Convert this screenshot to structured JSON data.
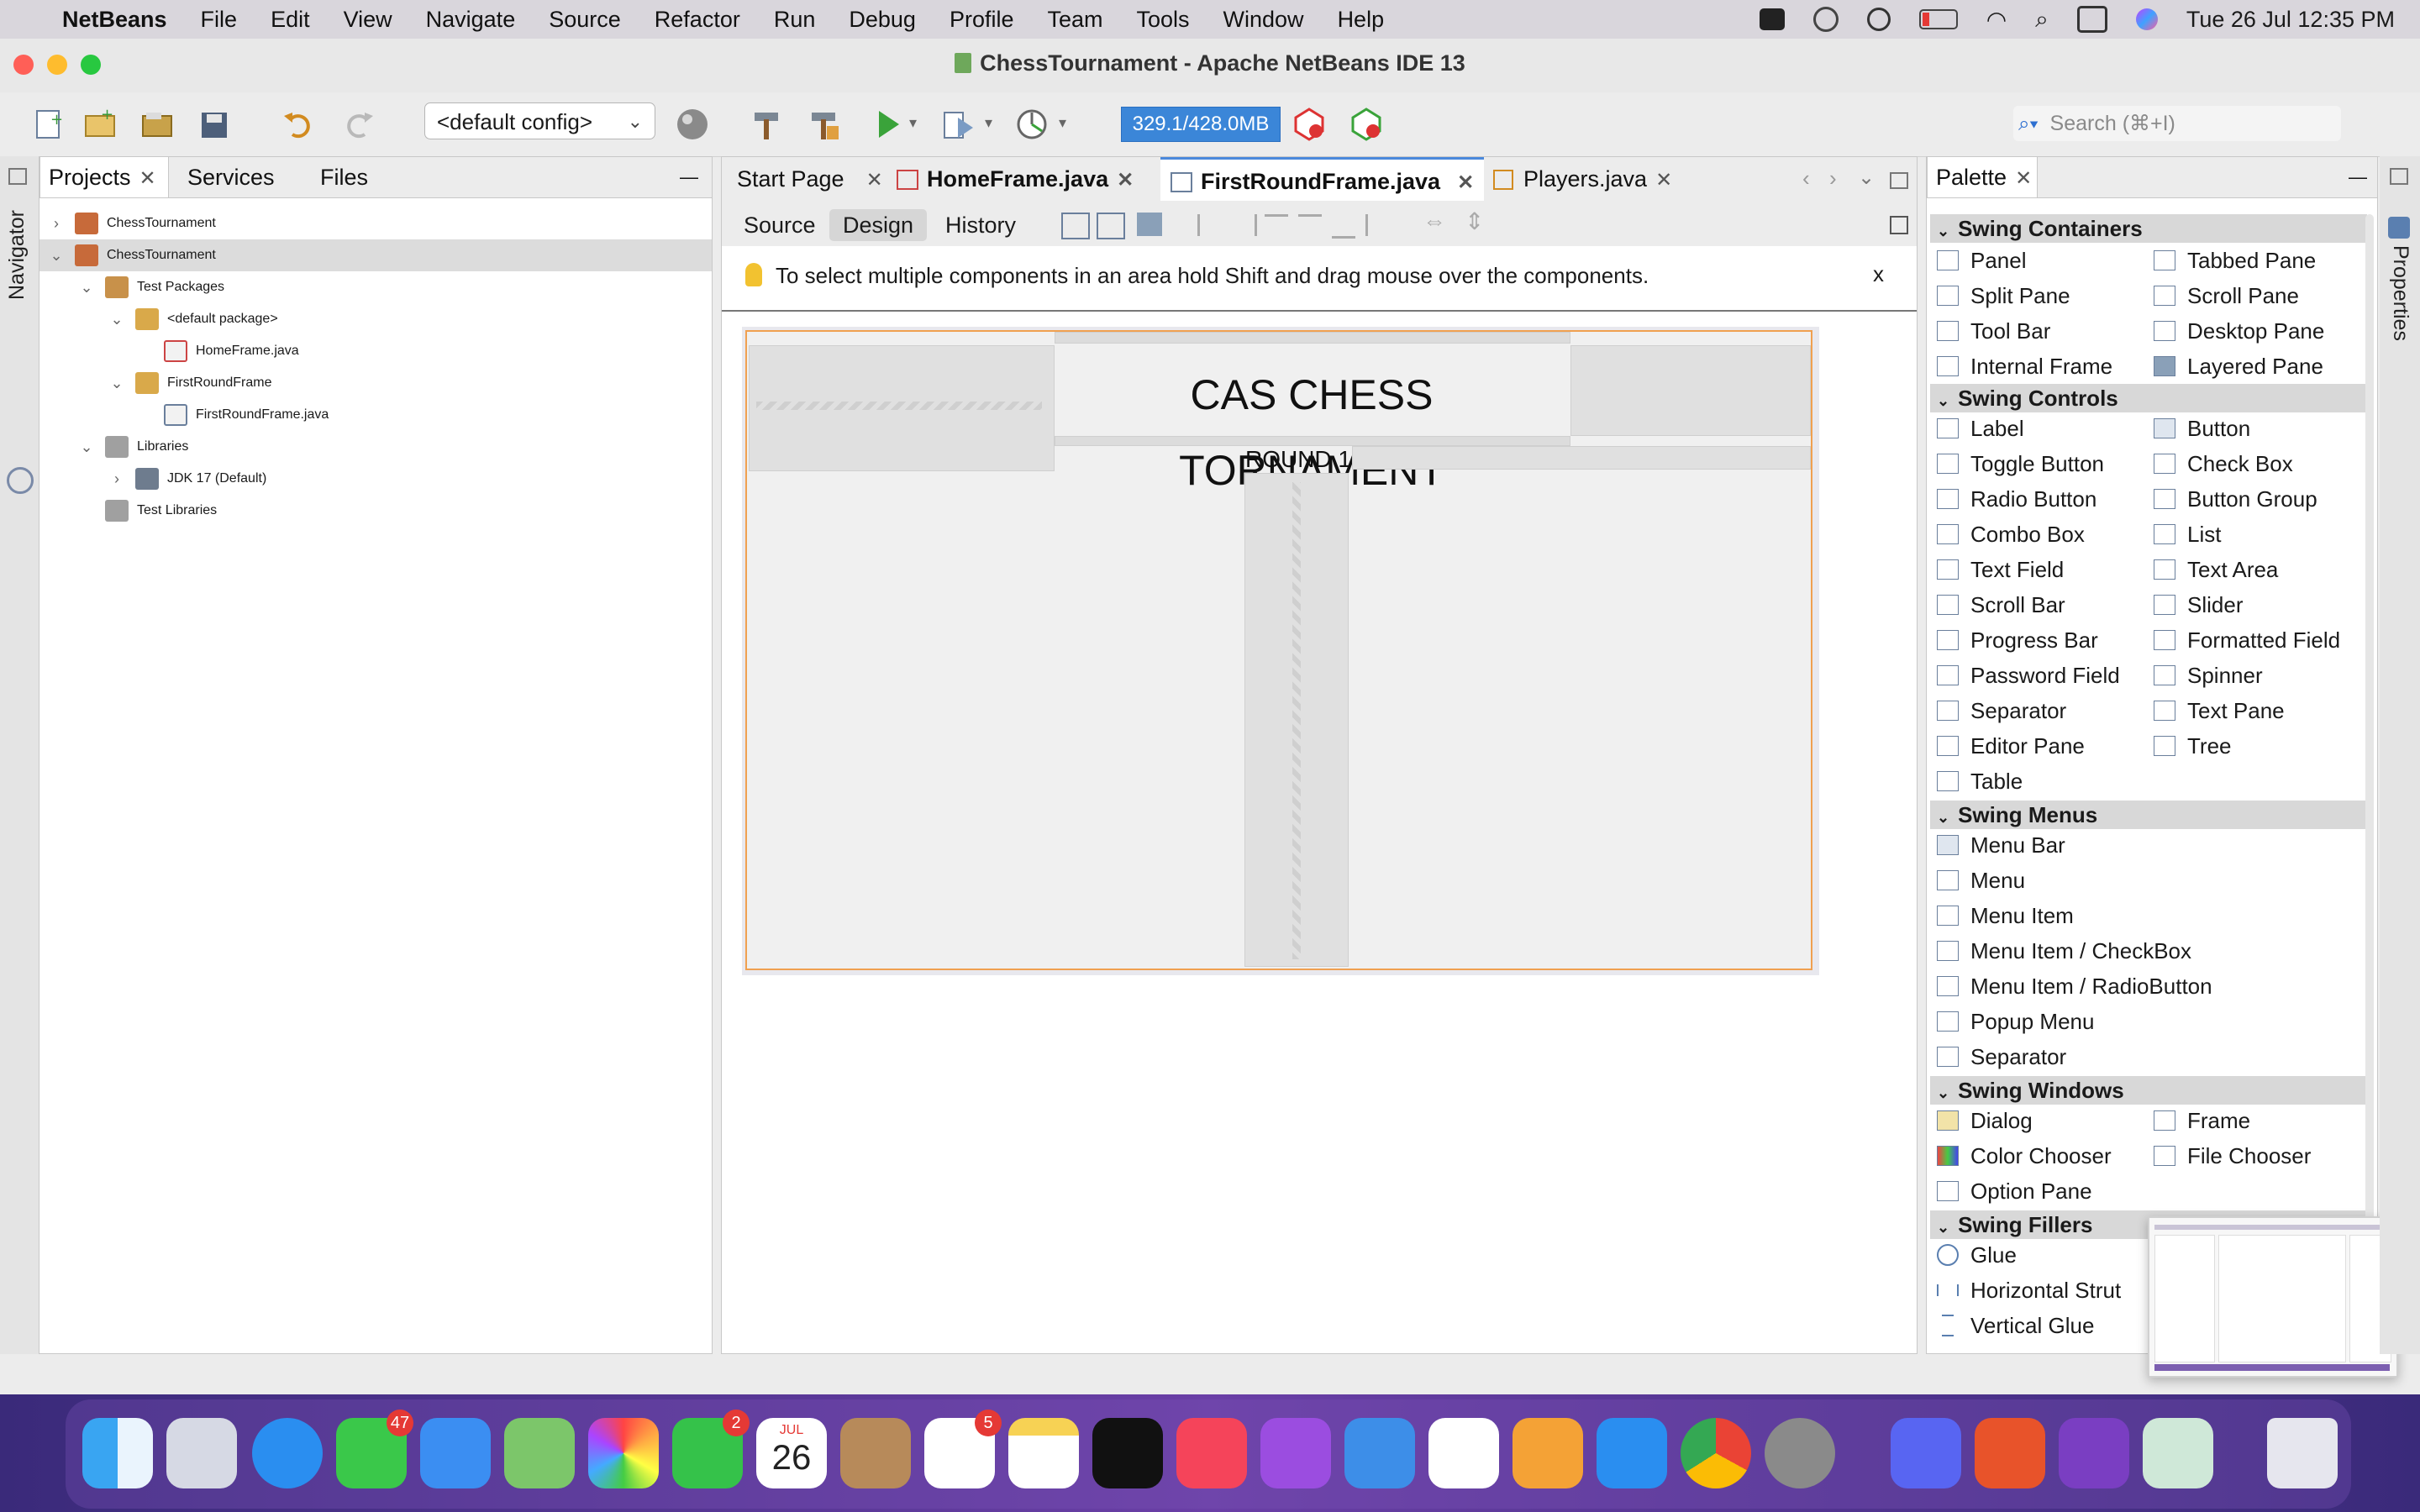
{
  "menubar": {
    "app_name": "NetBeans",
    "items": [
      "File",
      "Edit",
      "View",
      "Navigate",
      "Source",
      "Refactor",
      "Run",
      "Debug",
      "Profile",
      "Team",
      "Tools",
      "Window",
      "Help"
    ],
    "clock": "Tue 26 Jul  12:35 PM"
  },
  "window": {
    "title": "ChessTournament - Apache NetBeans IDE 13"
  },
  "toolbar": {
    "config_value": "<default config>",
    "memory": "329.1/428.0MB",
    "search_placeholder": "Search (⌘+I)"
  },
  "left_strip": {
    "navigator_label": "Navigator"
  },
  "right_strip": {
    "properties_label": "Properties"
  },
  "projects_panel": {
    "tabs": [
      "Projects",
      "Services",
      "Files"
    ],
    "tree": [
      {
        "label": "ChessTournament",
        "depth": 0,
        "twisty": "›"
      },
      {
        "label": "ChessTournament",
        "depth": 0,
        "twisty": "⌄",
        "selected": true
      },
      {
        "label": "Test Packages",
        "depth": 1,
        "twisty": "⌄"
      },
      {
        "label": "<default package>",
        "depth": 2,
        "twisty": "⌄"
      },
      {
        "label": "HomeFrame.java",
        "depth": 3,
        "twisty": ""
      },
      {
        "label": "FirstRoundFrame",
        "depth": 2,
        "twisty": "⌄"
      },
      {
        "label": "FirstRoundFrame.java",
        "depth": 3,
        "twisty": ""
      },
      {
        "label": "Libraries",
        "depth": 1,
        "twisty": "⌄"
      },
      {
        "label": "JDK 17 (Default)",
        "depth": 2,
        "twisty": "›"
      },
      {
        "label": "Test Libraries",
        "depth": 1,
        "twisty": ""
      }
    ]
  },
  "editor": {
    "tabs": [
      "Start Page",
      "HomeFrame.java",
      "FirstRoundFrame.java",
      "Players.java"
    ],
    "active_tab": "FirstRoundFrame.java",
    "subtabs": [
      "Source",
      "Design",
      "History"
    ],
    "active_subtab": "Design",
    "hint": "To select multiple components in an area hold Shift and drag mouse over the components.",
    "hint_close": "x",
    "form": {
      "title": "CAS CHESS TORNAMENT",
      "round_label": "ROUND 1"
    }
  },
  "palette": {
    "title": "Palette",
    "categories": [
      {
        "name": "Swing Containers",
        "items": [
          "Panel",
          "Tabbed Pane",
          "Split Pane",
          "Scroll Pane",
          "Tool Bar",
          "Desktop Pane",
          "Internal Frame",
          "Layered Pane"
        ]
      },
      {
        "name": "Swing Controls",
        "items": [
          "Label",
          "Button",
          "Toggle Button",
          "Check Box",
          "Radio Button",
          "Button Group",
          "Combo Box",
          "List",
          "Text Field",
          "Text Area",
          "Scroll Bar",
          "Slider",
          "Progress Bar",
          "Formatted Field",
          "Password Field",
          "Spinner",
          "Separator",
          "Text Pane",
          "Editor Pane",
          "Tree",
          "Table"
        ]
      },
      {
        "name": "Swing Menus",
        "items": [
          "Menu Bar",
          "Menu",
          "Menu Item",
          "Menu Item / CheckBox",
          "Menu Item / RadioButton",
          "Popup Menu",
          "Separator"
        ]
      },
      {
        "name": "Swing Windows",
        "items": [
          "Dialog",
          "Frame",
          "Color Chooser",
          "File Chooser",
          "Option Pane"
        ]
      },
      {
        "name": "Swing Fillers",
        "items": [
          "Glue",
          "Horizontal Strut",
          "Vertical Glue"
        ]
      }
    ]
  },
  "dock": {
    "apps": [
      "Finder",
      "Launchpad",
      "Safari",
      "Messages",
      "Mail",
      "Maps",
      "Photos",
      "FaceTime",
      "Calendar",
      "Contacts",
      "Reminders",
      "Notes",
      "TV",
      "Music",
      "Podcasts",
      "Keynote",
      "Numbers",
      "Pages",
      "App Store",
      "Chrome",
      "System Preferences",
      "Discord",
      "Git Client",
      "GitHub Desktop",
      "NetBeans",
      "Trash"
    ],
    "badges": {
      "Messages": "47",
      "FaceTime": "2",
      "Reminders": "5"
    },
    "calendar_month": "JUL",
    "calendar_day": "26"
  }
}
